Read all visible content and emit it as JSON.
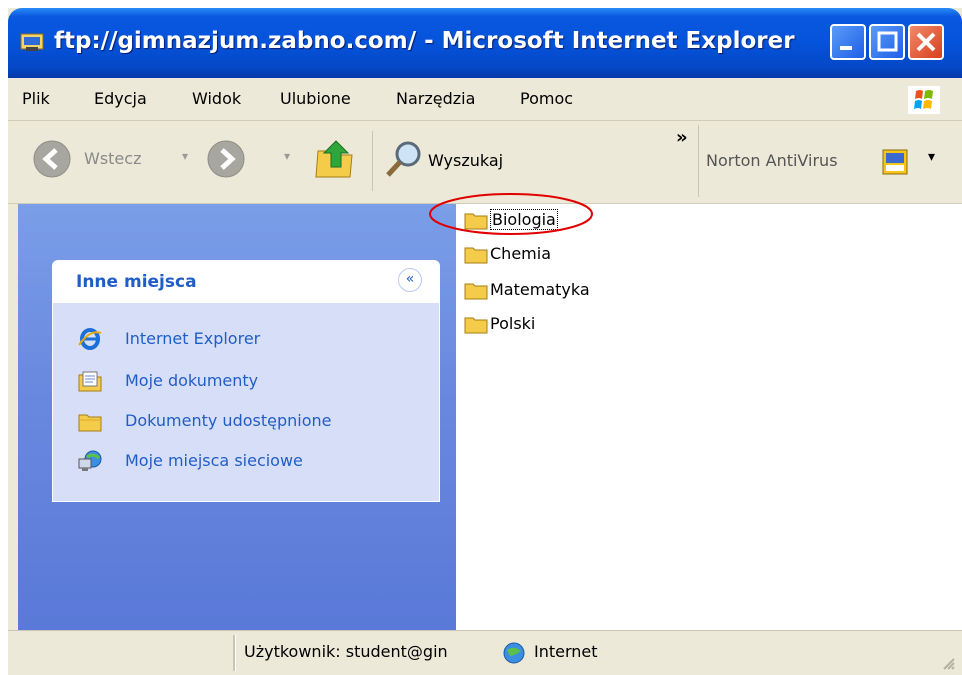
{
  "window": {
    "title": "ftp://gimnazjum.zabno.com/ - Microsoft Internet Explorer"
  },
  "menu": [
    "Plik",
    "Edycja",
    "Widok",
    "Ulubione",
    "Narzędzia",
    "Pomoc"
  ],
  "toolbar": {
    "back_label": "Wstecz",
    "search_label": "Wyszukaj",
    "overflow_label": "»",
    "norton_label": "Norton AntiVirus"
  },
  "sidebar": {
    "panel_title": "Inne miejsca",
    "collapse_glyph": "«",
    "places": [
      {
        "label": "Internet Explorer",
        "icon": "ie-icon"
      },
      {
        "label": "Moje dokumenty",
        "icon": "my-documents-icon"
      },
      {
        "label": "Dokumenty udostępnione",
        "icon": "shared-folder-icon"
      },
      {
        "label": "Moje miejsca sieciowe",
        "icon": "network-places-icon"
      }
    ]
  },
  "files": [
    "Biologia",
    "Chemia",
    "Matematyka",
    "Polski"
  ],
  "selected_file": "Biologia",
  "statusbar": {
    "user": "Użytkownik: student@gin",
    "zone": "Internet"
  },
  "colors": {
    "titlebar": "#0553da",
    "sidebar": "#6a8ae0",
    "link": "#215dc6",
    "annotation": "#e00000"
  }
}
